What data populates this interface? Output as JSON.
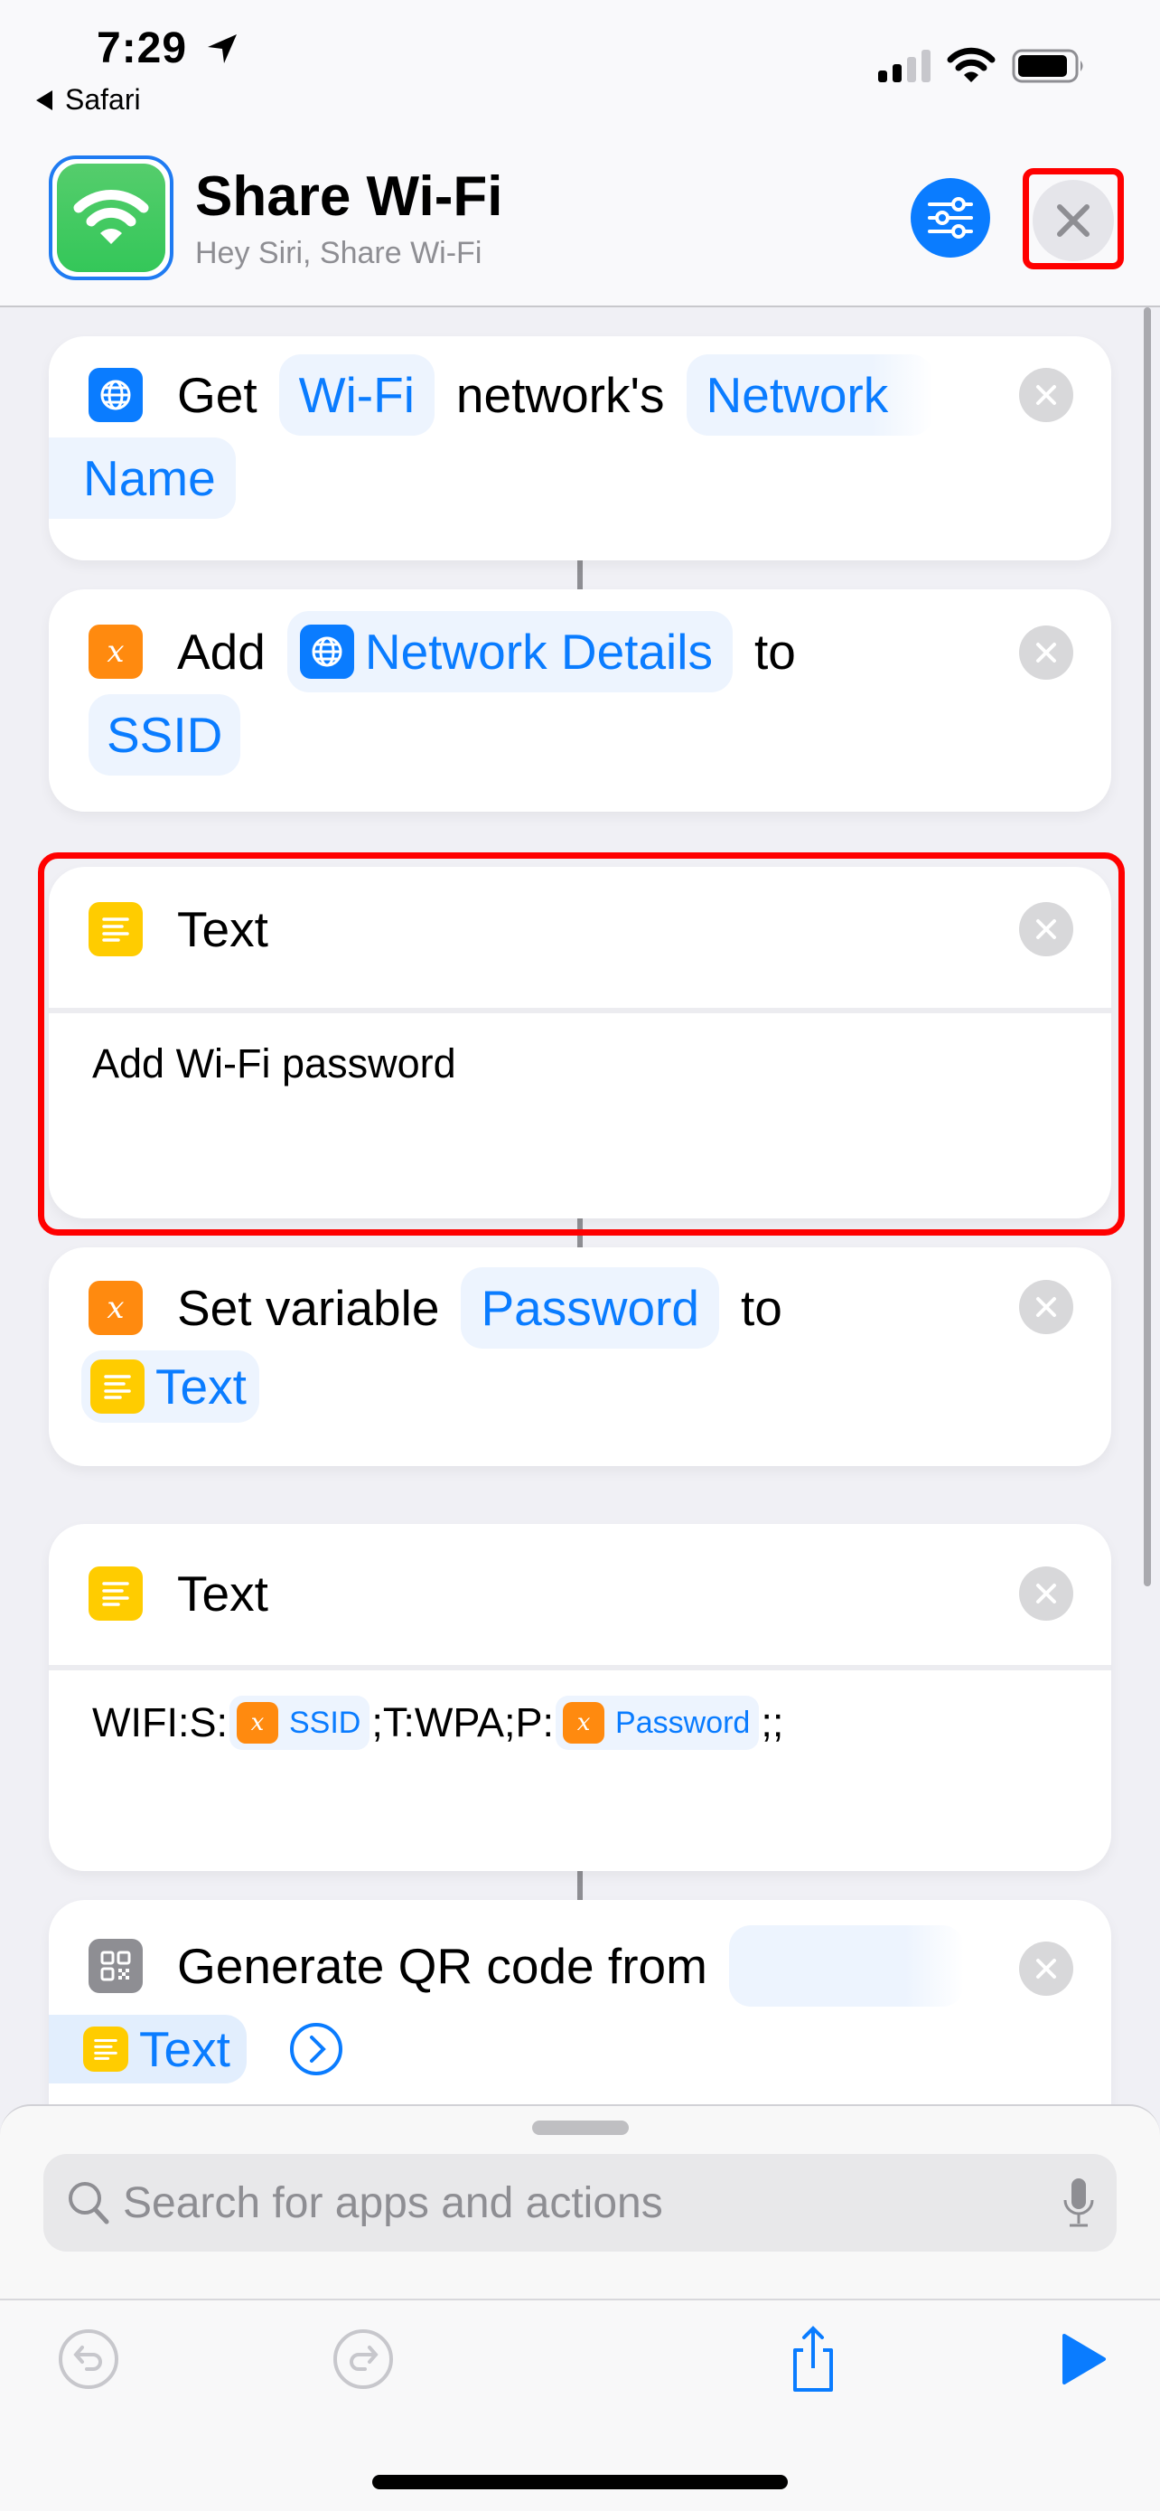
{
  "status_bar": {
    "time": "7:29",
    "back_app": "Safari",
    "signal_bars_filled": 2,
    "signal_bars_total": 4
  },
  "header": {
    "title": "Share Wi-Fi",
    "subtitle": "Hey Siri, Share Wi-Fi",
    "app_icon": "wifi-icon",
    "settings_icon": "sliders-icon",
    "close_icon": "close-icon"
  },
  "colors": {
    "accent": "#0a7cff",
    "app_icon_green": "#34c759",
    "variable_orange": "#ff8a0f",
    "text_yellow": "#ffcc00",
    "highlight_red": "#ff0000"
  },
  "actions": [
    {
      "icon": "globe-icon",
      "line1": {
        "verb": "Get",
        "param1": "Wi-Fi",
        "middle": "network's",
        "param2": "Network"
      },
      "line2": {
        "param2_cont": "Name"
      }
    },
    {
      "icon": "variable-icon",
      "line1": {
        "verb": "Add",
        "param": "Network Details",
        "param_icon": "globe-icon",
        "tail": "to"
      },
      "line2": {
        "param": "SSID"
      }
    },
    {
      "icon": "text-icon",
      "title": "Text",
      "body": "Add Wi-Fi password",
      "highlighted": true
    },
    {
      "icon": "variable-icon",
      "line1": {
        "verb": "Set variable",
        "param": "Password",
        "tail": "to"
      },
      "line2": {
        "param": "Text",
        "param_icon": "text-icon"
      }
    },
    {
      "icon": "text-icon",
      "title": "Text",
      "body": {
        "prefix": "WIFI:S:",
        "var1": "SSID",
        "middle": ";T:WPA;P:",
        "var2": "Password",
        "suffix": ";;"
      }
    },
    {
      "icon": "qr-code-icon",
      "line1": {
        "verb": "Generate QR code from",
        "param": ""
      },
      "line2": {
        "param": "Text",
        "param_icon": "text-icon",
        "more_icon": "chevron-right-circle-icon"
      }
    }
  ],
  "bottom_sheet": {
    "search_placeholder": "Search for apps and actions"
  },
  "toolbar": {
    "undo_icon": "undo-icon",
    "redo_icon": "redo-icon",
    "share_icon": "share-icon",
    "run_icon": "play-icon"
  }
}
